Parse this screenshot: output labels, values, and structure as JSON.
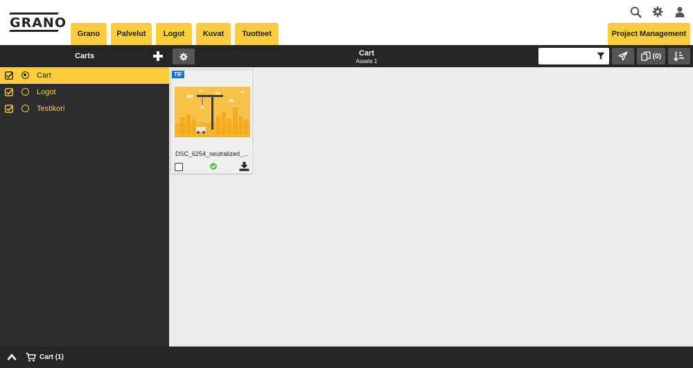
{
  "header": {
    "logo_text": "GRANO",
    "nav_tabs": [
      {
        "label": "Grano"
      },
      {
        "label": "Palvelut"
      },
      {
        "label": "Logot"
      },
      {
        "label": "Kuvat"
      },
      {
        "label": "Tuotteet"
      }
    ],
    "project_tab": "Project Management",
    "icons": [
      "search-icon",
      "gear-icon",
      "user-icon"
    ]
  },
  "toolbar": {
    "carts_title": "Carts",
    "center_title": "Cart",
    "center_subtitle": "Assets 1",
    "filter_value": "",
    "copies_label": "(0)"
  },
  "sidebar": {
    "items": [
      {
        "label": "Cart",
        "checked": true,
        "selected": true
      },
      {
        "label": "Logot",
        "checked": true,
        "selected": false
      },
      {
        "label": "Testikori",
        "checked": true,
        "selected": false
      }
    ]
  },
  "assets": [
    {
      "badge": "TIF",
      "filename": "DSC_6254_neutralized_...",
      "status": "ok"
    }
  ],
  "footer": {
    "cart_label": "Cart (1)"
  },
  "colors": {
    "accent": "#fbcd3f",
    "dark": "#262626",
    "sidebar": "#2d2d2d",
    "content": "#ededed",
    "badge": "#1f6fc5",
    "ok": "#5cc24a"
  }
}
